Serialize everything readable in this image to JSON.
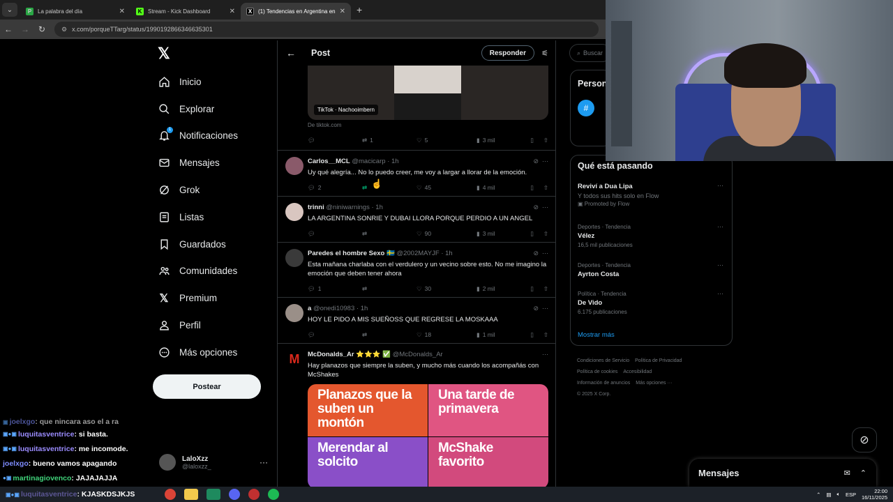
{
  "browser": {
    "tabs": [
      {
        "title": "La palabra del día",
        "icon_color": "#2aa745",
        "icon_letter": "P"
      },
      {
        "title": "Stream - Kick Dashboard",
        "icon_color": "#53fc18",
        "icon_letter": "K"
      },
      {
        "title": "(1) Tendencias en Argentina en",
        "icon_color": "#000000",
        "icon_letter": "X"
      }
    ],
    "url": "x.com/porqueTTarg/status/1990192866346635301"
  },
  "nav": {
    "items": [
      {
        "label": "Inicio",
        "icon": "home-icon"
      },
      {
        "label": "Explorar",
        "icon": "search-icon"
      },
      {
        "label": "Notificaciones",
        "icon": "bell-icon",
        "badge": "1"
      },
      {
        "label": "Mensajes",
        "icon": "mail-icon"
      },
      {
        "label": "Grok",
        "icon": "grok-icon"
      },
      {
        "label": "Listas",
        "icon": "list-icon"
      },
      {
        "label": "Guardados",
        "icon": "bookmark-icon"
      },
      {
        "label": "Comunidades",
        "icon": "people-icon"
      },
      {
        "label": "Premium",
        "icon": "x-icon"
      },
      {
        "label": "Perfil",
        "icon": "person-icon"
      },
      {
        "label": "Más opciones",
        "icon": "more-circle-icon"
      }
    ],
    "post_button": "Postear",
    "account": {
      "name": "LaloXzz",
      "handle": "@laloxzz_"
    }
  },
  "chat": [
    {
      "user": "joelxgo",
      "msg": ": que nincara aso el a ra",
      "color": "#7e8cff"
    },
    {
      "user": "luquitasventrice",
      "msg": ": si basta.",
      "color": "#9b8cff"
    },
    {
      "user": "luquitasventrice",
      "msg": ": me incomode.",
      "color": "#9b8cff"
    },
    {
      "user": "joelxgo",
      "msg": ": bueno vamos apagando",
      "color": "#7e8cff"
    },
    {
      "user": "martinagiovenco",
      "msg": ": JAJAJAJJA",
      "color": "#40d27a"
    },
    {
      "user": "luquitasventrice",
      "msg": ": KJASKDSJKJS",
      "color": "#9b8cff"
    }
  ],
  "post": {
    "header_title": "Post",
    "reply_button": "Responder",
    "media": {
      "tag": "TikTok · Nachooimbern",
      "source": "De tiktok.com"
    },
    "top_actions": {
      "replies": "",
      "reposts": "1",
      "likes": "5",
      "views": "3 mil"
    }
  },
  "replies": [
    {
      "name": "Carlos__MCL",
      "handle": "@macicarp",
      "time": "· 1h",
      "text": "Uy qué alegría... No lo puedo creer, me voy a largar a llorar de la emoción.",
      "replies": "2",
      "reposts": "",
      "likes": "45",
      "views": "4 mil",
      "avatar_color": "#8a5a6a"
    },
    {
      "name": "trinni",
      "handle": "@niniwarnings",
      "time": "· 1h",
      "text": "LA ARGENTINA SONRIE Y DUBAI LLORA PORQUE PERDIO A UN ANGEL",
      "replies": "",
      "reposts": "",
      "likes": "90",
      "views": "3 mil",
      "avatar_color": "#d9c6c0"
    },
    {
      "name": "Paredes el hombre Sexo 🇸🇪",
      "handle": "@2002MAYJF",
      "time": "· 1h",
      "text": "Esta mañana charlaba con el verdulero y un vecino sobre esto. No me imagino la emoción que deben tener ahora",
      "replies": "1",
      "reposts": "",
      "likes": "30",
      "views": "2 mil",
      "avatar_color": "#3a3a3a"
    },
    {
      "name": "a",
      "handle": "@onedi10983",
      "time": "· 1h",
      "text": "HOY LE PIDO A MIS SUEÑOSS QUE REGRESE LA MOSKAAA",
      "replies": "",
      "reposts": "",
      "likes": "18",
      "views": "1 mil",
      "avatar_color": "#9a8f88"
    },
    {
      "name": "McDonalds_Ar ⭐⭐⭐ ✅",
      "handle": "@McDonalds_Ar",
      "time": "",
      "text": "Hay planazos que siempre la suben, y mucho más cuando los acompañás con McShakes",
      "avatar_color": "#da291c"
    }
  ],
  "promo_tiles": [
    "Planazos que la suben un montón",
    "Una tarde de primavera",
    "Merendar al solcito",
    "McShake favorito"
  ],
  "right": {
    "search_placeholder": "Buscar",
    "persona_title": "Person",
    "trends_title": "Qué está pasando",
    "trends": [
      {
        "cat": "",
        "name": "Reviví a Dua Lipa",
        "count": "Y todos sus hits solo en Flow",
        "promo": "Promoted by Flow"
      },
      {
        "cat": "Deportes · Tendencia",
        "name": "Vélez",
        "count": "16,5 mil publicaciones"
      },
      {
        "cat": "Deportes · Tendencia",
        "name": "Ayrton Costa",
        "count": ""
      },
      {
        "cat": "Política · Tendencia",
        "name": "De Vido",
        "count": "6.175 publicaciones"
      }
    ],
    "show_more": "Mostrar más",
    "footer": [
      "Condiciones de Servicio",
      "Política de Privacidad",
      "Política de cookies",
      "Accesibilidad",
      "Información de anuncios",
      "Más opciones ···",
      "© 2025 X Corp."
    ],
    "messages_title": "Mensajes"
  },
  "taskbar": {
    "lang": "ESP",
    "time": "22:00",
    "date": "16/11/2025"
  }
}
